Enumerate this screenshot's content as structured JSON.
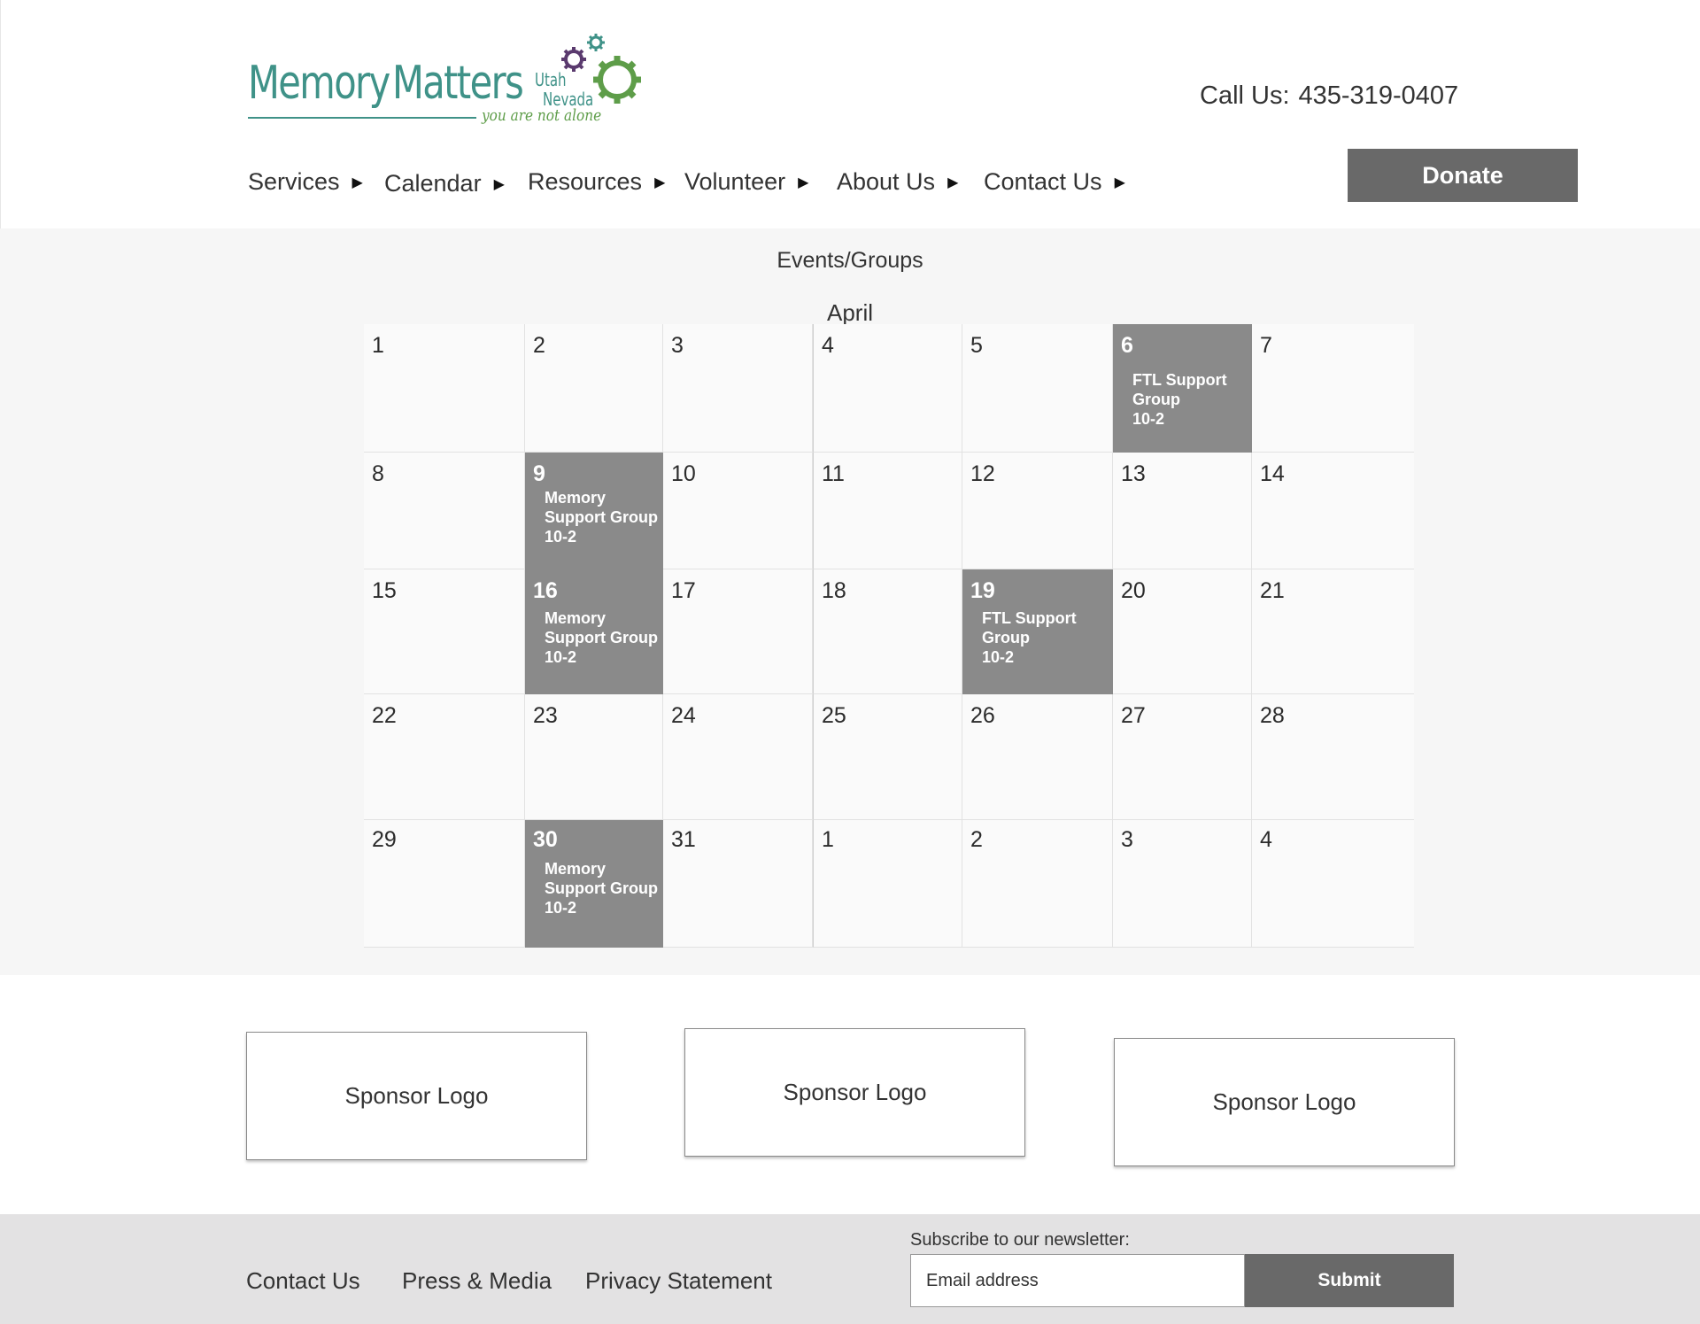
{
  "header": {
    "logo": {
      "word1": "Memory",
      "word2": "Matters",
      "region1": "Utah",
      "region2": "Nevada",
      "tagline": "you are not alone"
    },
    "call_label": "Call Us:",
    "phone": "435-319-0407",
    "donate_label": "Donate",
    "nav": [
      {
        "label": "Services"
      },
      {
        "label": "Calendar"
      },
      {
        "label": "Resources"
      },
      {
        "label": "Volunteer"
      },
      {
        "label": "About Us"
      },
      {
        "label": "Contact Us"
      }
    ],
    "caret_glyph": "▶"
  },
  "events": {
    "title": "Events/Groups",
    "month": "April",
    "weeks": [
      [
        {
          "day": "1"
        },
        {
          "day": "2"
        },
        {
          "day": "3"
        },
        {
          "day": "4"
        },
        {
          "day": "5"
        },
        {
          "day": "6",
          "event": "FTL Support\nGroup\n10-2"
        },
        {
          "day": "7"
        }
      ],
      [
        {
          "day": "8"
        },
        {
          "day": "9",
          "event": "Memory\nSupport Group\n10-2"
        },
        {
          "day": "10"
        },
        {
          "day": "11"
        },
        {
          "day": "12"
        },
        {
          "day": "13"
        },
        {
          "day": "14"
        }
      ],
      [
        {
          "day": "15"
        },
        {
          "day": "16",
          "event": "Memory\nSupport Group\n10-2"
        },
        {
          "day": "17"
        },
        {
          "day": "18"
        },
        {
          "day": "19",
          "event": "FTL Support\nGroup\n10-2"
        },
        {
          "day": "20"
        },
        {
          "day": "21"
        }
      ],
      [
        {
          "day": "22"
        },
        {
          "day": "23"
        },
        {
          "day": "24"
        },
        {
          "day": "25"
        },
        {
          "day": "26"
        },
        {
          "day": "27"
        },
        {
          "day": "28"
        }
      ],
      [
        {
          "day": "29"
        },
        {
          "day": "30",
          "event": "Memory\nSupport Group\n10-2"
        },
        {
          "day": "31"
        },
        {
          "day": "1"
        },
        {
          "day": "2"
        },
        {
          "day": "3"
        },
        {
          "day": "4"
        }
      ]
    ]
  },
  "sponsors": [
    {
      "label": "Sponsor Logo"
    },
    {
      "label": "Sponsor Logo"
    },
    {
      "label": "Sponsor Logo"
    }
  ],
  "footer": {
    "links": [
      {
        "label": "Contact Us"
      },
      {
        "label": "Press & Media"
      },
      {
        "label": "Privacy Statement"
      }
    ],
    "newsletter_label": "Subscribe to our newsletter:",
    "email_placeholder": "Email address",
    "submit_label": "Submit"
  },
  "colors": {
    "brand_teal": "#3f9288",
    "brand_green": "#5e9d49",
    "brand_purple": "#5a3a6e",
    "button_gray": "#696969",
    "event_gray": "#8a8a8a",
    "footer_bg": "#e3e2e3"
  },
  "icons": [
    "gear-icon",
    "caret-right-icon"
  ]
}
